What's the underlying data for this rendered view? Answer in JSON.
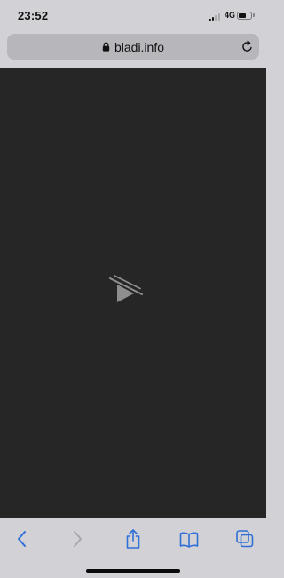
{
  "status_bar": {
    "time": "23:52",
    "network": "4G",
    "battery_level": 0.6
  },
  "address_bar": {
    "url": "bladi.info",
    "secure_icon": "lock-icon",
    "reload_icon": "reload-icon"
  },
  "content": {
    "state": "video-unavailable",
    "icon": "video-unavailable-icon",
    "background": "#262626"
  },
  "toolbar": {
    "accent_color": "#2f6fd6",
    "disabled_color": "#a8a8ae",
    "items": [
      {
        "name": "back",
        "icon": "chevron-left-icon",
        "enabled": true
      },
      {
        "name": "forward",
        "icon": "chevron-right-icon",
        "enabled": false
      },
      {
        "name": "share",
        "icon": "share-icon",
        "enabled": true
      },
      {
        "name": "bookmarks",
        "icon": "book-icon",
        "enabled": true
      },
      {
        "name": "tabs",
        "icon": "tabs-icon",
        "enabled": true
      }
    ]
  }
}
